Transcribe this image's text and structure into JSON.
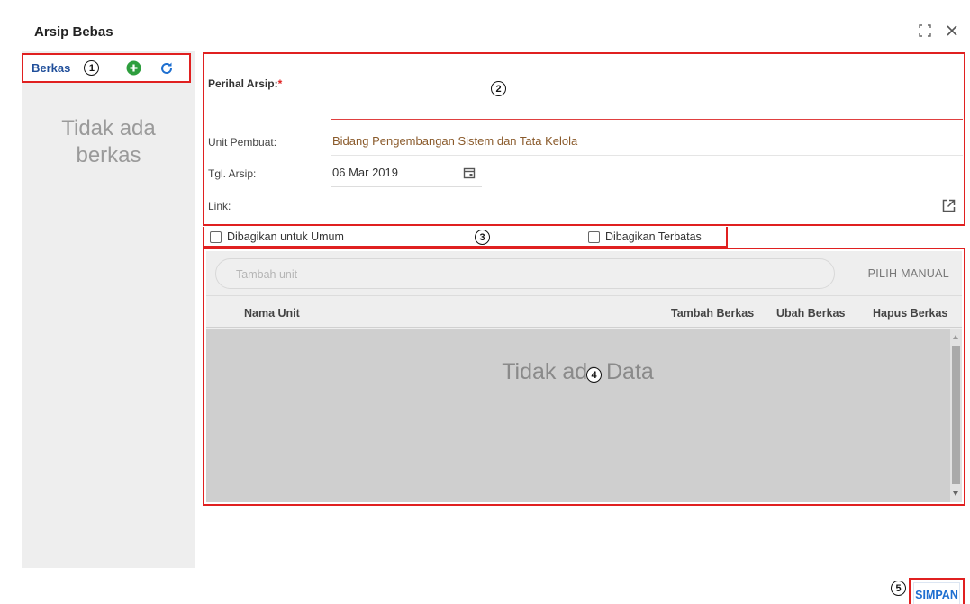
{
  "dialog": {
    "title": "Arsip Bebas"
  },
  "left": {
    "header_label": "Berkas",
    "callout": "1",
    "empty_text_line1": "Tidak ada",
    "empty_text_line2": "berkas"
  },
  "form": {
    "callout": "2",
    "perihal_label": "Perihal Arsip:",
    "required_mark": "*",
    "unit_label": "Unit Pembuat:",
    "unit_value": "Bidang Pengembangan Sistem dan Tata Kelola",
    "tgl_label": "Tgl. Arsip:",
    "tgl_value": "06 Mar 2019",
    "link_label": "Link:"
  },
  "share": {
    "callout": "3",
    "umum_label": "Dibagikan untuk Umum",
    "terbatas_label": "Dibagikan Terbatas"
  },
  "units": {
    "callout": "4",
    "search_placeholder": "Tambah unit",
    "pilih_manual": "PILIH MANUAL",
    "columns": [
      "Nama Unit",
      "Tambah Berkas",
      "Ubah Berkas",
      "Hapus Berkas"
    ],
    "empty_text": "Tidak ada Data"
  },
  "footer": {
    "callout": "5",
    "save_label": "SIMPAN"
  },
  "colors": {
    "highlight_border": "#e02020",
    "link_blue": "#1f4e9a",
    "add_green": "#2e9e3e",
    "refresh_blue": "#1e6fd0",
    "unit_text_brown": "#8a5a2b"
  },
  "icons": [
    "add-icon",
    "refresh-icon",
    "maximize-icon",
    "close-icon",
    "calendar-icon",
    "external-link-icon"
  ]
}
